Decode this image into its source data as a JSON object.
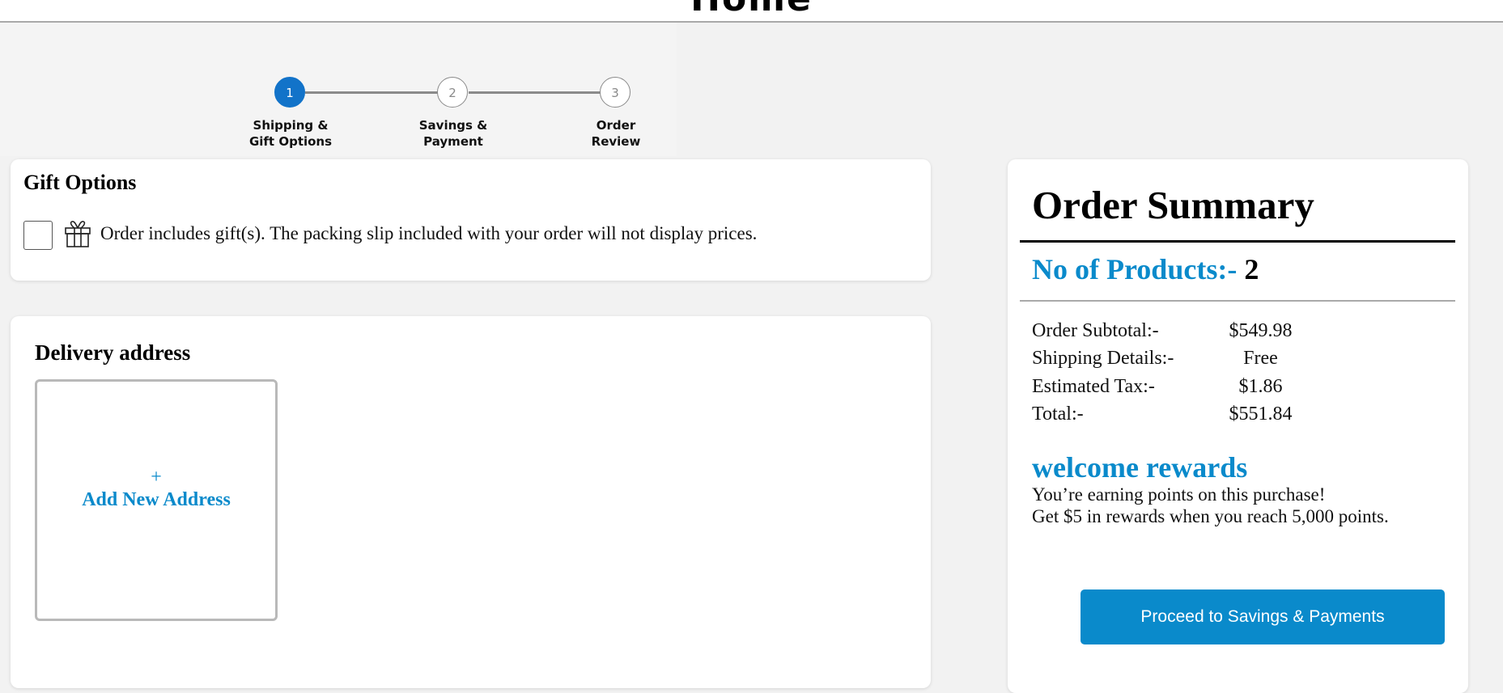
{
  "header": {
    "title": "Home"
  },
  "stepper": {
    "steps": [
      {
        "number": "1",
        "label": "Shipping &\nGift Options",
        "state": "active"
      },
      {
        "number": "2",
        "label": "Savings &\nPayment",
        "state": "inactive"
      },
      {
        "number": "3",
        "label": "Order\nReview",
        "state": "inactive"
      }
    ]
  },
  "gift_options": {
    "heading": "Gift Options",
    "checkbox_checked": false,
    "icon": "gift-icon",
    "text": "Order includes gift(s). The packing slip included with your order will not display prices."
  },
  "delivery": {
    "heading": "Delivery address",
    "add_address": {
      "plus": "+",
      "label": "Add New Address"
    }
  },
  "order_summary": {
    "title": "Order Summary",
    "products_label": "No of Products:-",
    "products_count": "2",
    "rows": [
      {
        "label": "Order Subtotal:-",
        "value": "$549.98"
      },
      {
        "label": "Shipping Details:-",
        "value": "Free"
      },
      {
        "label": "Estimated Tax:-",
        "value": "$1.86"
      },
      {
        "label": "Total:-",
        "value": "$551.84"
      }
    ],
    "rewards_title": "welcome rewards",
    "rewards_line1": "You’re earning points on this purchase!",
    "rewards_line2": "Get $5 in rewards when you reach 5,000 points.",
    "proceed_label": "Proceed to Savings & Payments"
  },
  "colors": {
    "accent": "#0a8acb",
    "step_active": "#1273c9",
    "background": "#f2f2f2"
  }
}
